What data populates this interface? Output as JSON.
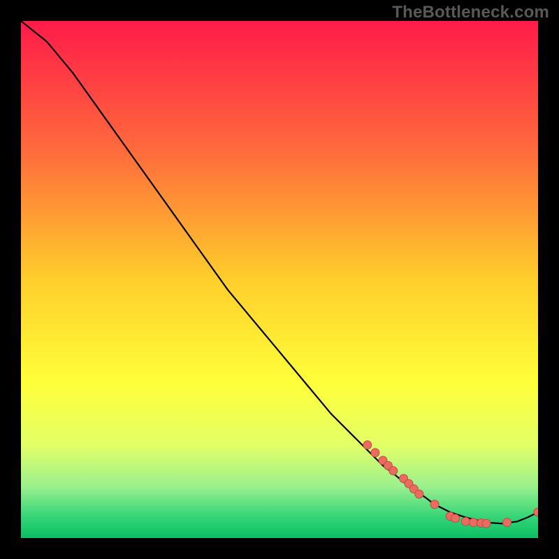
{
  "watermark": "TheBottleneck.com",
  "chart_data": {
    "type": "line",
    "title": "",
    "xlabel": "",
    "ylabel": "",
    "xlim": [
      0,
      100
    ],
    "ylim": [
      0,
      100
    ],
    "gradient_stops": [
      {
        "offset": 0,
        "color": "#ff1b49"
      },
      {
        "offset": 25,
        "color": "#ff6a3c"
      },
      {
        "offset": 50,
        "color": "#ffce2b"
      },
      {
        "offset": 70,
        "color": "#ffff3a"
      },
      {
        "offset": 82,
        "color": "#e3ff66"
      },
      {
        "offset": 90,
        "color": "#9cf08e"
      },
      {
        "offset": 96,
        "color": "#34d477"
      },
      {
        "offset": 100,
        "color": "#0cbf63"
      }
    ],
    "series": [
      {
        "name": "curve",
        "x": [
          0,
          5,
          10,
          15,
          20,
          25,
          30,
          35,
          40,
          45,
          50,
          55,
          60,
          65,
          70,
          72,
          75,
          78,
          80,
          83,
          86,
          90,
          93,
          96,
          98,
          100
        ],
        "y": [
          100,
          96,
          90,
          83,
          76,
          69,
          62,
          55,
          48,
          42,
          36,
          30,
          24,
          19,
          14,
          12.5,
          10,
          8,
          6.5,
          5,
          4,
          3,
          2.8,
          3.2,
          4,
          5
        ]
      }
    ],
    "markers": {
      "color": "#ec6b5e",
      "stroke": "#b84f45",
      "radius": 6,
      "points": [
        {
          "x": 67,
          "y": 18
        },
        {
          "x": 68.5,
          "y": 16.5
        },
        {
          "x": 70,
          "y": 15
        },
        {
          "x": 71,
          "y": 14
        },
        {
          "x": 72,
          "y": 13
        },
        {
          "x": 74,
          "y": 11.5
        },
        {
          "x": 75,
          "y": 10.5
        },
        {
          "x": 76,
          "y": 9.5
        },
        {
          "x": 77,
          "y": 8.5
        },
        {
          "x": 80,
          "y": 6.5
        },
        {
          "x": 83,
          "y": 4.2
        },
        {
          "x": 84,
          "y": 3.8
        },
        {
          "x": 86,
          "y": 3.2
        },
        {
          "x": 87.5,
          "y": 3
        },
        {
          "x": 89,
          "y": 2.9
        },
        {
          "x": 90,
          "y": 2.8
        },
        {
          "x": 94,
          "y": 3
        },
        {
          "x": 100,
          "y": 5
        }
      ]
    }
  }
}
